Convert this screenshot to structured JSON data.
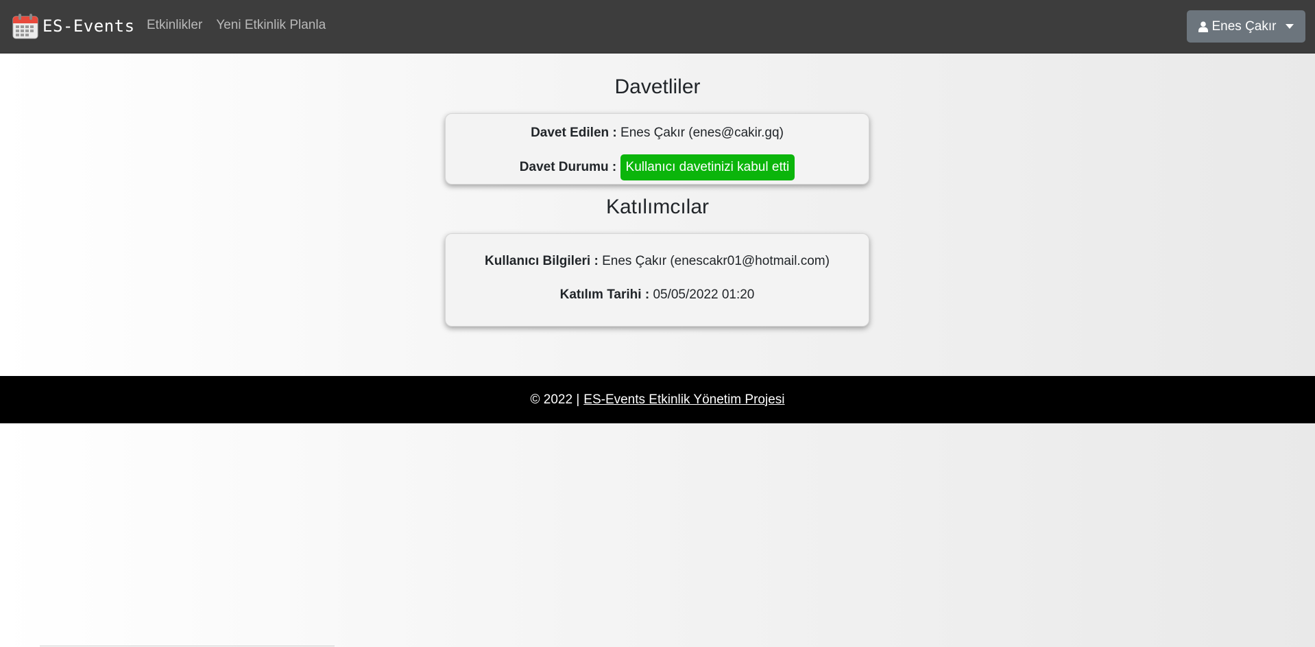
{
  "navbar": {
    "brand_icon": "calendar-icon",
    "brand": "ES-Events",
    "links": [
      {
        "label": "Etkinlikler"
      },
      {
        "label": "Yeni Etkinlik Planla"
      }
    ],
    "user_icon": "user-icon",
    "user_name": "Enes Çakır"
  },
  "invitees": {
    "title": "Davetliler",
    "invited_label": "Davet Edilen :",
    "invited_value": "Enes Çakır (enes@cakir.gq)",
    "status_label": "Davet Durumu :",
    "status_value": "Kullanıcı davetinizi kabul etti",
    "status_color": "#0bb50b"
  },
  "participants": {
    "title": "Katılımcılar",
    "user_label": "Kullanıcı Bilgileri :",
    "user_value": "Enes Çakır (enescakr01@hotmail.com)",
    "date_label": "Katılım Tarihi :",
    "date_value": "05/05/2022 01:20"
  },
  "footer": {
    "copyright": "© 2022 |",
    "link": "ES-Events Etkinlik Yönetim Projesi"
  },
  "colors": {
    "navbar_bg": "#3d3d3d",
    "user_button_bg": "#6c757d",
    "footer_bg": "#000000",
    "accent_success": "#0bb50b"
  }
}
